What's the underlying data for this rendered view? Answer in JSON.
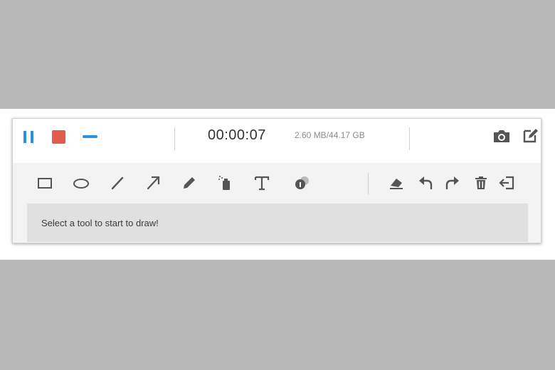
{
  "recorder": {
    "timer": "00:00:07",
    "file_size": "2.60 MB/44.17 GB"
  },
  "colors": {
    "accent_blue": "#2d8fe0",
    "stop_red": "#e35b4d",
    "icon_gray": "#555555"
  },
  "toolbar": {
    "tools": [
      "rectangle-icon",
      "ellipse-icon",
      "line-icon",
      "arrow-icon",
      "pencil-icon",
      "spray-icon",
      "text-icon",
      "blur-icon"
    ],
    "actions": [
      "eraser-icon",
      "undo-icon",
      "redo-icon",
      "trash-icon",
      "exit-icon"
    ]
  },
  "canvas": {
    "hint": "Select a tool to start to draw!"
  }
}
